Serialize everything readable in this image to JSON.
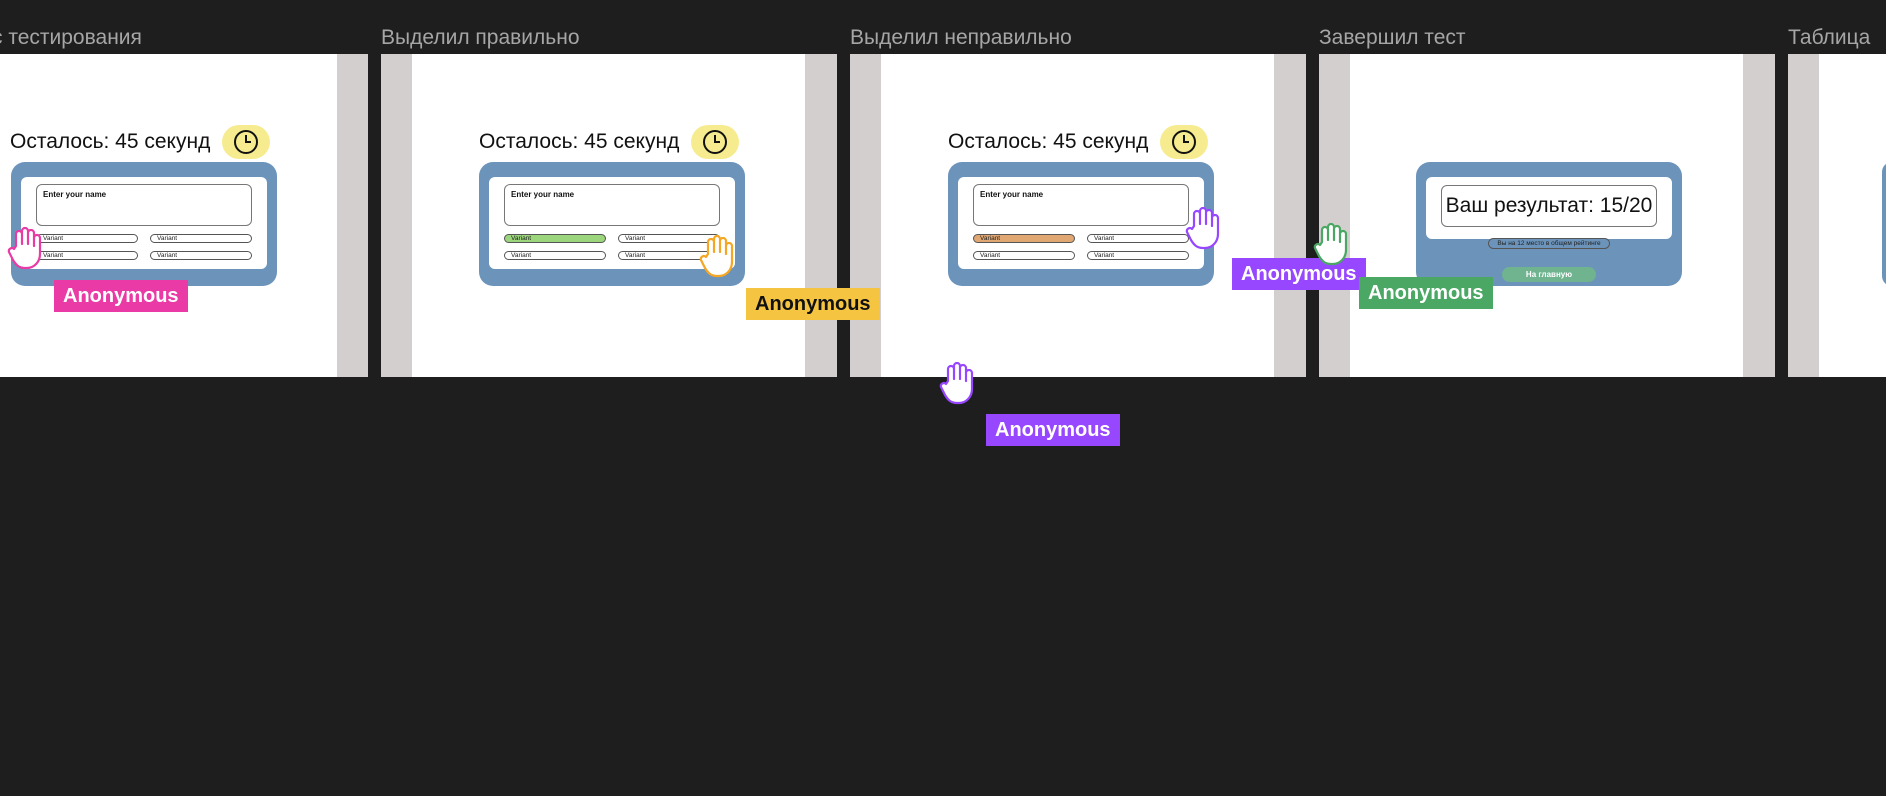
{
  "frames": [
    {
      "title": "с тестирования"
    },
    {
      "title": "Выделил правильно"
    },
    {
      "title": "Выделил неправильно"
    },
    {
      "title": "Завершил тест"
    },
    {
      "title": "Таблица"
    }
  ],
  "quiz": {
    "timer_text": "Осталось: 45 секунд",
    "name_placeholder": "Enter your name",
    "variant": "Variant"
  },
  "result": {
    "score_text": "Ваш результат: 15/20",
    "rank_text": "Вы на 12 место в общем рейтинге",
    "home_label": "На главную"
  },
  "cursors": [
    {
      "label": "Anonymous",
      "color": "#e93aa5",
      "text_color": "#ffffff"
    },
    {
      "label": "Anonymous",
      "color": "#f5c542",
      "text_color": "#111111"
    },
    {
      "label": "Anonymous",
      "color": "#9747ff",
      "text_color": "#ffffff"
    },
    {
      "label": "Anonymous",
      "color": "#9747ff",
      "text_color": "#ffffff"
    },
    {
      "label": "Anonymous",
      "color": "#4aa864",
      "text_color": "#ffffff"
    }
  ],
  "colors": {
    "canvas": "#1e1e1e",
    "card": "#6c94bb",
    "correct": "#9bd67c",
    "wrong": "#e0a773",
    "clock_bg": "#f6ec8f",
    "home_button": "#6fb38f"
  }
}
